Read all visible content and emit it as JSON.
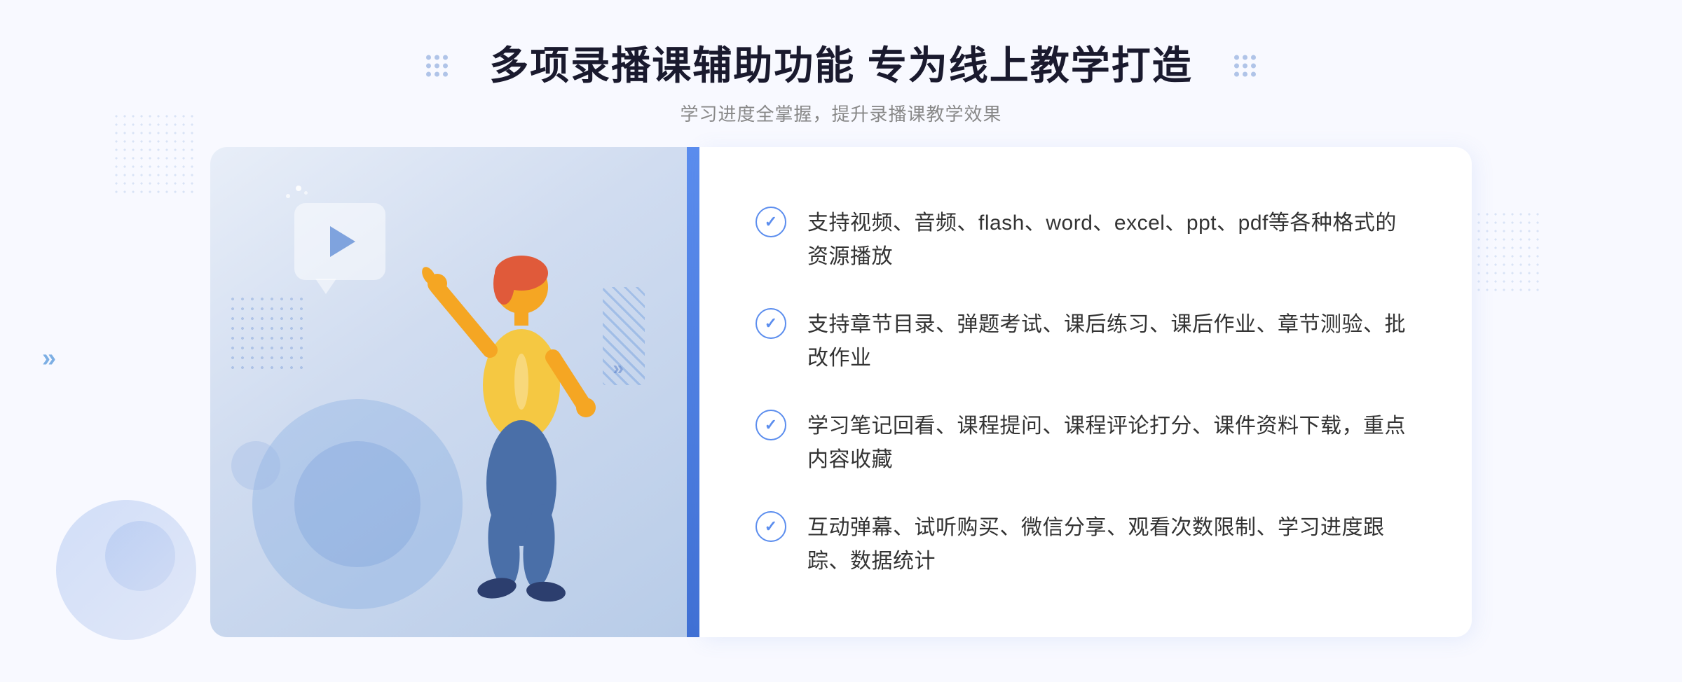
{
  "page": {
    "background_color": "#f5f7fd"
  },
  "header": {
    "title": "多项录播课辅助功能 专为线上教学打造",
    "subtitle": "学习进度全掌握，提升录播课教学效果"
  },
  "features": [
    {
      "id": 1,
      "text": "支持视频、音频、flash、word、excel、ppt、pdf等各种格式的资源播放"
    },
    {
      "id": 2,
      "text": "支持章节目录、弹题考试、课后练习、课后作业、章节测验、批改作业"
    },
    {
      "id": 3,
      "text": "学习笔记回看、课程提问、课程评论打分、课件资料下载，重点内容收藏"
    },
    {
      "id": 4,
      "text": "互动弹幕、试听购买、微信分享、观看次数限制、学习进度跟踪、数据统计"
    }
  ],
  "icons": {
    "check": "✓",
    "play": "▶",
    "chevron": "»"
  },
  "colors": {
    "primary_blue": "#5b8dee",
    "dark_blue": "#4070d4",
    "light_bg": "#e8eef8",
    "text_dark": "#1a1a2e",
    "text_gray": "#888888",
    "text_body": "#333333",
    "white": "#ffffff"
  }
}
